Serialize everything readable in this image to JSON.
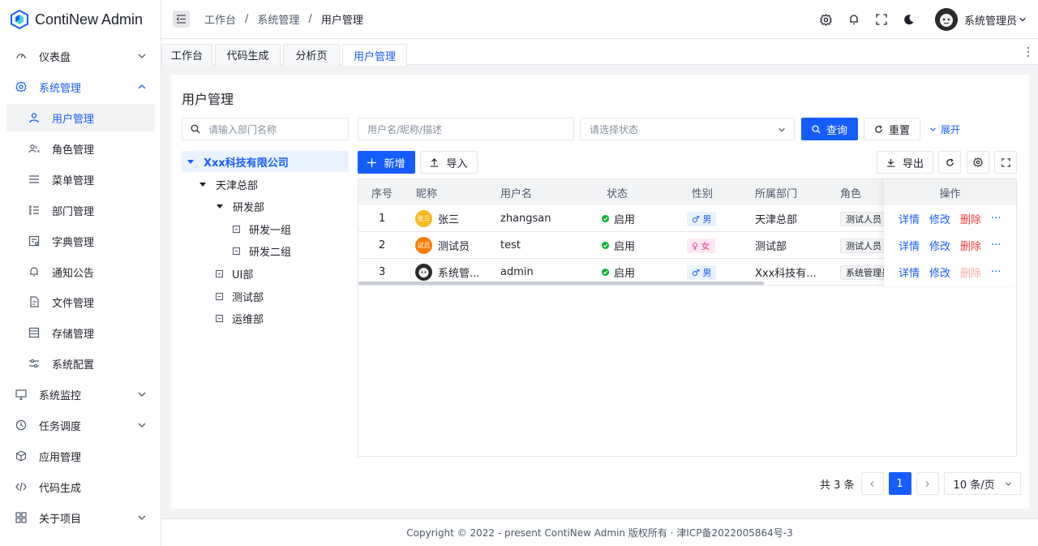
{
  "app": {
    "title": "ContiNew Admin"
  },
  "sidebar": {
    "items": [
      {
        "label": "仪表盘",
        "icon": "dashboard-icon"
      },
      {
        "label": "系统管理",
        "icon": "gear-icon"
      },
      {
        "label": "用户管理",
        "icon": "user-icon"
      },
      {
        "label": "角色管理",
        "icon": "users-icon"
      },
      {
        "label": "菜单管理",
        "icon": "menu-icon"
      },
      {
        "label": "部门管理",
        "icon": "tree-icon"
      },
      {
        "label": "字典管理",
        "icon": "dictionary-icon"
      },
      {
        "label": "通知公告",
        "icon": "bell-icon"
      },
      {
        "label": "文件管理",
        "icon": "file-icon"
      },
      {
        "label": "存储管理",
        "icon": "storage-icon"
      },
      {
        "label": "系统配置",
        "icon": "sliders-icon"
      },
      {
        "label": "系统监控",
        "icon": "monitor-icon"
      },
      {
        "label": "任务调度",
        "icon": "clock-icon"
      },
      {
        "label": "应用管理",
        "icon": "cube-icon"
      },
      {
        "label": "代码生成",
        "icon": "code-icon"
      },
      {
        "label": "关于项目",
        "icon": "apps-icon"
      }
    ]
  },
  "header": {
    "breadcrumb": [
      "工作台",
      "系统管理",
      "用户管理"
    ],
    "separator": "/",
    "username": "系统管理员"
  },
  "tabs": [
    "工作台",
    "代码生成",
    "分析页",
    "用户管理"
  ],
  "page": {
    "title": "用户管理",
    "dept_search_placeholder": "请输入部门名称",
    "user_search_placeholder": "用户名/昵称/描述",
    "status_placeholder": "请选择状态",
    "query_label": "查询",
    "reset_label": "重置",
    "expand_label": "展开",
    "add_label": "新增",
    "import_label": "导入",
    "export_label": "导出"
  },
  "tree": {
    "root": "Xxx科技有限公司",
    "branch": "天津总部",
    "rd": "研发部",
    "rd1": "研发一组",
    "rd2": "研发二组",
    "ui": "UI部",
    "test": "测试部",
    "ops": "运维部"
  },
  "table": {
    "headers": [
      "序号",
      "昵称",
      "用户名",
      "状态",
      "性别",
      "所属部门",
      "角色",
      "操作"
    ],
    "rows": [
      {
        "index": "1",
        "avatar_text": "张三",
        "nickname": "张三",
        "username": "zhangsan",
        "status": "启用",
        "gender": "♂ 男",
        "dept": "天津总部",
        "role": "测试人员"
      },
      {
        "index": "2",
        "avatar_text": "试员",
        "nickname": "测试员",
        "username": "test",
        "status": "启用",
        "gender": "♀ 女",
        "dept": "测试部",
        "role": "测试人员"
      },
      {
        "index": "3",
        "avatar_text": "",
        "nickname": "系统管...",
        "username": "admin",
        "status": "启用",
        "gender": "♂ 男",
        "dept": "Xxx科技有...",
        "role": "系统管理员"
      }
    ],
    "actions": {
      "detail": "详情",
      "edit": "修改",
      "delete": "删除",
      "more": "···"
    }
  },
  "pagination": {
    "total": "共 3 条",
    "current": "1",
    "page_size": "10 条/页"
  },
  "footer": {
    "text": "Copyright © 2022 - present ContiNew Admin 版权所有 · 津ICP备2022005864号-3"
  },
  "colors": {
    "primary": "#165dff",
    "success": "#00b42a",
    "danger": "#f53f3f"
  }
}
